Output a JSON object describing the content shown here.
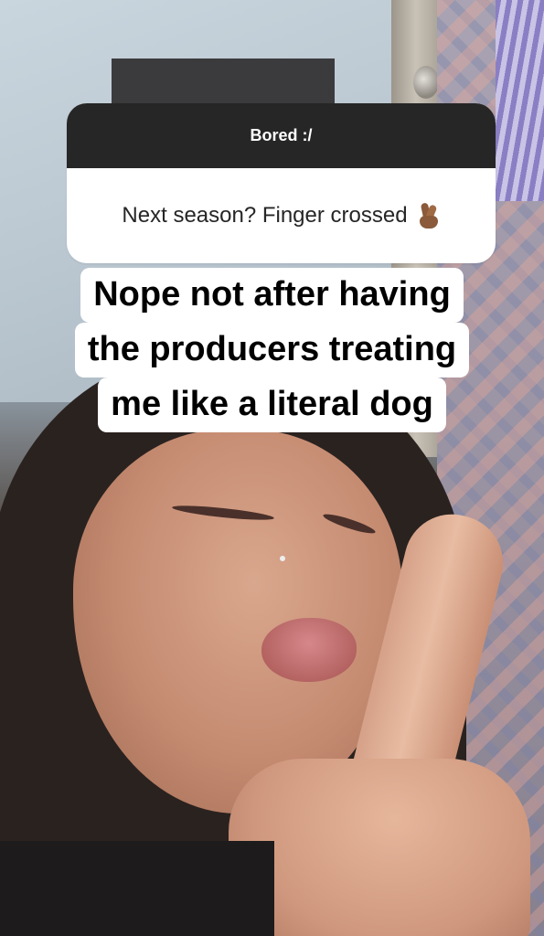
{
  "question_sticker": {
    "header": "Bored :/",
    "question": "Next season? Finger crossed",
    "emoji": "crossed-fingers-emoji"
  },
  "answer_caption": {
    "lines": [
      "Nope not after having",
      "the producers treating",
      "me like a literal dog"
    ],
    "text_color": "#000000",
    "background_color": "#ffffff"
  },
  "colors": {
    "sticker_header_bg": "#262626",
    "sticker_body_bg": "#ffffff"
  }
}
